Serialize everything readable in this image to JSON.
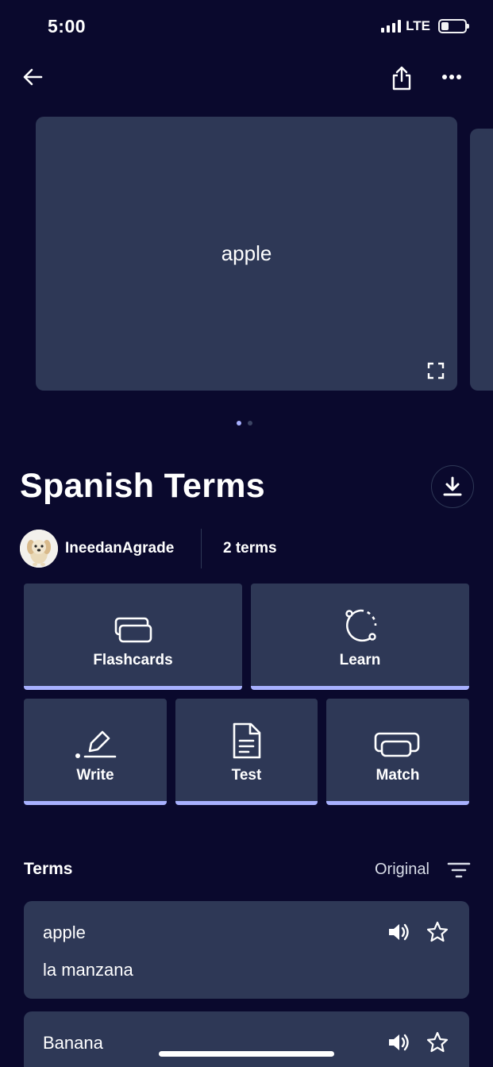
{
  "status_bar": {
    "time": "5:00",
    "network": "LTE",
    "battery_percent": 20
  },
  "nav": {
    "back_icon": "arrow-left-icon",
    "share_icon": "share-icon",
    "more_icon": "more-horizontal-icon"
  },
  "carousel": {
    "card_text": "apple",
    "page_count": 2,
    "active_page": 1
  },
  "set": {
    "title": "Spanish Terms",
    "author": "IneedanAgrade",
    "term_count": "2 terms"
  },
  "study_modes": [
    {
      "label": "Flashcards",
      "icon": "flashcards-icon"
    },
    {
      "label": "Learn",
      "icon": "learn-icon"
    },
    {
      "label": "Write",
      "icon": "write-icon"
    },
    {
      "label": "Test",
      "icon": "test-icon"
    },
    {
      "label": "Match",
      "icon": "match-icon"
    }
  ],
  "terms_section": {
    "heading": "Terms",
    "sort_label": "Original",
    "items": [
      {
        "term": "apple",
        "definition": "la manzana"
      },
      {
        "term": "Banana",
        "definition": ""
      }
    ]
  },
  "colors": {
    "background": "#0a092d",
    "card": "#2e3856",
    "accent": "#a8b1ff",
    "dot_active": "#a8b1ff",
    "dot_inactive": "#3b4463"
  }
}
